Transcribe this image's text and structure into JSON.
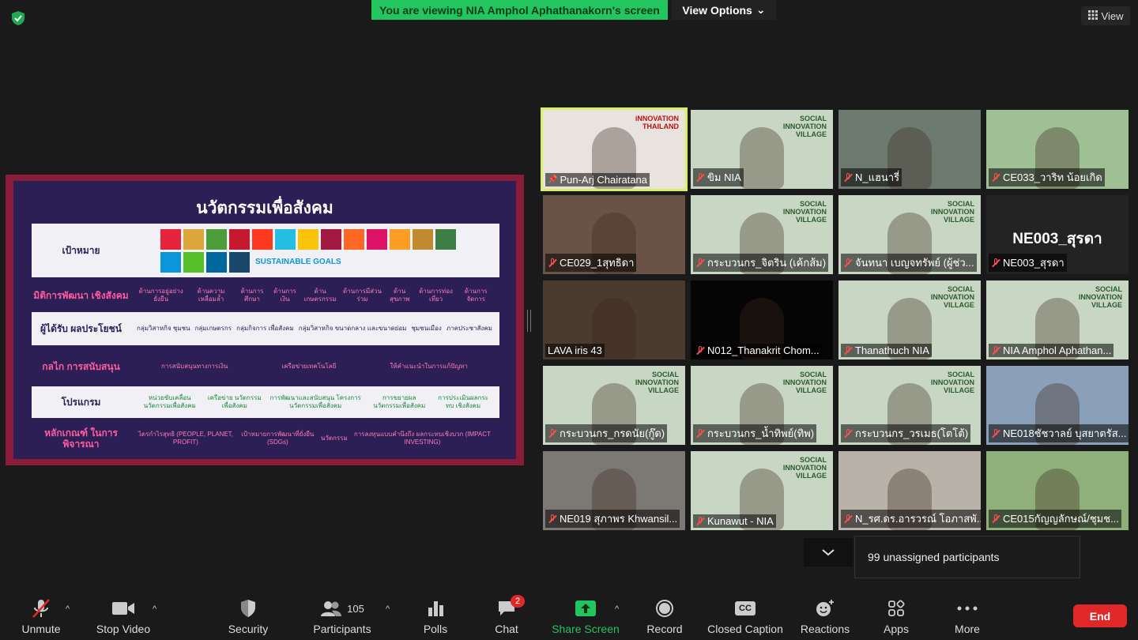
{
  "top": {
    "banner": "You are viewing NIA Amphol Aphathanakorn's screen",
    "view_options": "View Options",
    "view": "View"
  },
  "slide": {
    "title": "นวัตกรรมเพื่อสังคม",
    "rows": [
      {
        "label": "เป้าหมาย",
        "cells": [],
        "extra": "SUSTAINABLE GOALS"
      },
      {
        "label": "มิติการพัฒนา เชิงสังคม",
        "cells": [
          "ด้านการอยู่อย่าง ยั่งยืน",
          "ด้านความเหลื่อมล้ำ",
          "ด้านการศึกษา",
          "ด้านการเงิน",
          "ด้านเกษตรกรรม",
          "ด้านการมีส่วนร่วม",
          "ด้านสุขภาพ",
          "ด้านการท่องเที่ยว",
          "ด้านการจัดการ"
        ]
      },
      {
        "label": "ผู้ได้รับ ผลประโยชน์",
        "cells": [
          "กลุ่มวิสาหกิจ ชุมชน",
          "กลุ่มเกษตรกร",
          "กลุ่มกิจการ เพื่อสังคม",
          "กลุ่มวิสาหกิจ ขนาดกลาง และขนาดย่อม",
          "ชุมชนเมือง",
          "ภาคประชาสังคม"
        ]
      },
      {
        "label": "กลไก การสนับสนุน",
        "cells": [
          "การสนับสนุนทางการเงิน",
          "เครือข่ายเทคโนโลยี",
          "ให้คำแนะนำในการแก้ปัญหา"
        ]
      },
      {
        "label": "โปรแกรม",
        "cells": [
          "หน่วยขับเคลื่อน นวัตกรรมเพื่อสังคม",
          "เครือข่าย นวัตกรรมเพื่อสังคม",
          "การพัฒนาและสนับสนุน โครงการนวัตกรรมเพื่อสังคม",
          "การขยายผล นวัตกรรมเพื่อสังคม",
          "การประเมินผลกระทบ เชิงสังคม"
        ]
      },
      {
        "label": "หลักเกณฑ์ ในการพิจารณา",
        "cells": [
          "ไตรกำไรสุทธิ (PEOPLE, PLANET, PROFIT)",
          "เป้าหมายการพัฒนาที่ยั่งยืน (SDGs)",
          "นวัตกรรม",
          "การลงทุนแบบคำนึงถึง ผลกระทบเชิงบวก (IMPACT INVESTING)"
        ]
      }
    ],
    "sdg_colors": [
      "#e5243b",
      "#dda63a",
      "#4c9f38",
      "#c5192d",
      "#ff3a21",
      "#26bde2",
      "#fcc30b",
      "#a21942",
      "#fd6925",
      "#dd1367",
      "#fd9d24",
      "#bf8b2e",
      "#3f7e44",
      "#0a97d9",
      "#56c02b",
      "#00689d",
      "#19486a"
    ]
  },
  "participants": [
    {
      "name": "Pun-Arj Chairatana",
      "muted": false,
      "pinned": true,
      "active": true,
      "bg": "#e9e3e0",
      "banner_text": "iNNOVATION THAILAND"
    },
    {
      "name": "ขิม NIA",
      "muted": true,
      "bg": "#c8d7c4",
      "banner_text": "SOCIAL INNOVATION VILLAGE"
    },
    {
      "name": "N_แฮนารี่",
      "muted": true,
      "bg": "#6d7a70"
    },
    {
      "name": "CE033_วาริท น้อยเกิด",
      "muted": true,
      "bg": "#9fbf95"
    },
    {
      "name": "CE029_1สุทธิดา",
      "muted": true,
      "bg": "#6a5346"
    },
    {
      "name": "กระบวนกร_จิตริน (เค้กส้ม)",
      "muted": true,
      "bg": "#c8d7c4",
      "banner_text": "SOCIAL INNOVATION VILLAGE"
    },
    {
      "name": "จันทนา เบญจทรัพย์ (ผู้ช่ว...",
      "muted": true,
      "bg": "#c8d7c4",
      "banner_text": "SOCIAL INNOVATION VILLAGE"
    },
    {
      "name": "NE003_สุรดา",
      "muted": true,
      "bg": "#232323",
      "big": "NE003_สุรดา"
    },
    {
      "name": "LAVA iris 43",
      "muted": false,
      "bg": "#4a3a30"
    },
    {
      "name": "N012_Thanakrit Chom...",
      "muted": true,
      "bg": "#050505"
    },
    {
      "name": "Thanathuch NIA",
      "muted": true,
      "bg": "#c8d7c4",
      "banner_text": "SOCIAL INNOVATION VILLAGE"
    },
    {
      "name": "NIA Amphol Aphathan...",
      "muted": true,
      "bg": "#c8d7c4",
      "banner_text": "SOCIAL INNOVATION VILLAGE"
    },
    {
      "name": "กระบวนกร_กรดนัย(กู๊ด)",
      "muted": true,
      "bg": "#c8d7c4",
      "banner_text": "SOCIAL INNOVATION VILLAGE"
    },
    {
      "name": "กระบวนกร_น้ำทิพย์(ทิพ)",
      "muted": true,
      "bg": "#c8d7c4",
      "banner_text": "SOCIAL INNOVATION VILLAGE"
    },
    {
      "name": "กระบวนกร_วรเมธ(โตโต้)",
      "muted": true,
      "bg": "#c8d7c4",
      "banner_text": "SOCIAL INNOVATION VILLAGE"
    },
    {
      "name": "NE018ชัชวาลย์ บุสยาตรัส...",
      "muted": true,
      "bg": "#8aa0b8"
    },
    {
      "name": "NE019 สุภาพร Khwansil...",
      "muted": true,
      "bg": "#7c7874"
    },
    {
      "name": "Kunawut - NIA",
      "muted": true,
      "bg": "#c8d7c4",
      "banner_text": "SOCIAL INNOVATION VILLAGE"
    },
    {
      "name": "N_รศ.ดร.อารวรณ์ โอภาสพั...",
      "muted": true,
      "bg": "#b9b2a8"
    },
    {
      "name": "CE015กัญญลักษณ์/ชุมช...",
      "muted": true,
      "bg": "#8fb07a"
    }
  ],
  "notice": {
    "unassigned": "99 unassigned participants"
  },
  "toolbar": {
    "unmute": "Unmute",
    "stop_video": "Stop Video",
    "security": "Security",
    "participants": "Participants",
    "participants_count": "105",
    "polls": "Polls",
    "chat": "Chat",
    "chat_badge": "2",
    "share_screen": "Share Screen",
    "record": "Record",
    "closed_caption": "Closed Caption",
    "cc": "CC",
    "reactions": "Reactions",
    "apps": "Apps",
    "more": "More",
    "end": "End"
  },
  "colors": {
    "banner_green": "#22c55e",
    "end_red": "#e02828",
    "active_tile": "#d8ef6a",
    "share_green": "#22c55e"
  }
}
